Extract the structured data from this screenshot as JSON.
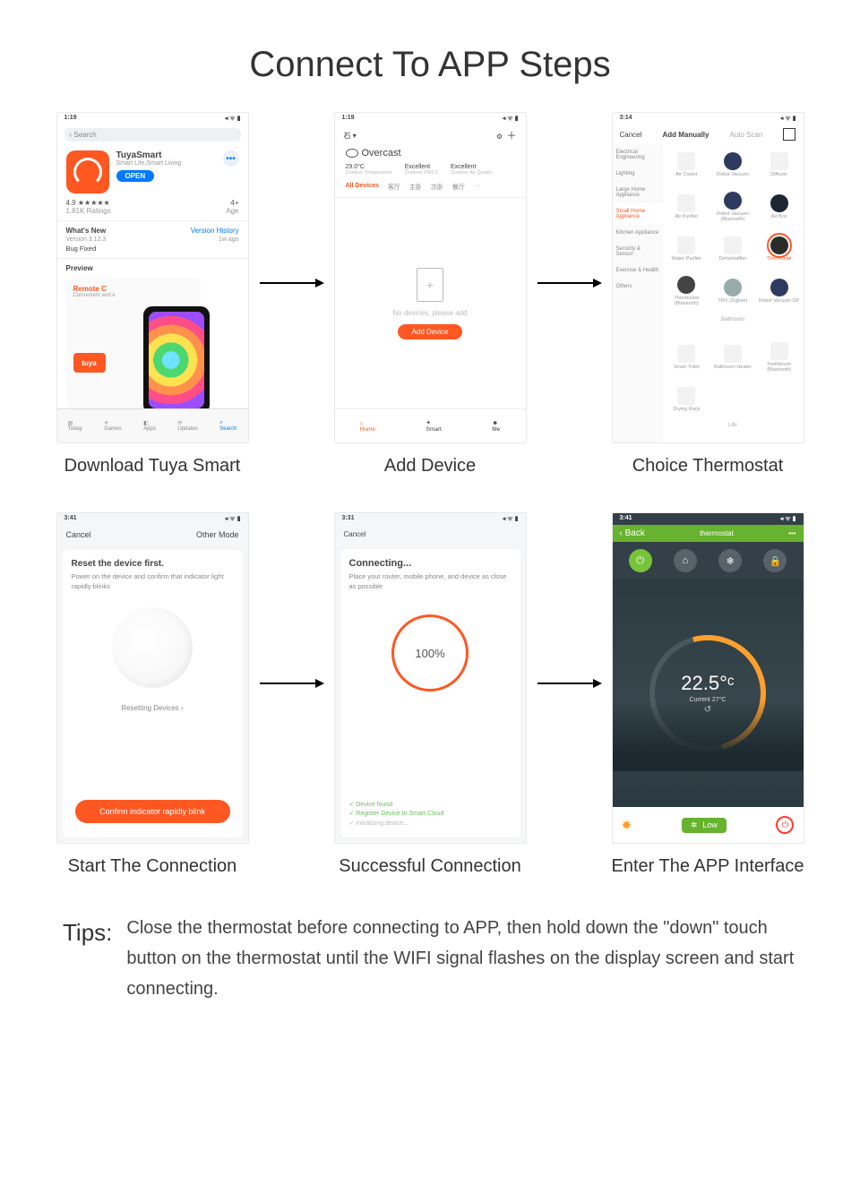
{
  "title": "Connect To APP Steps",
  "captions": {
    "step1": "Download Tuya Smart",
    "step2": "Add Device",
    "step3": "Choice Thermostat",
    "step4": "Start The Connection",
    "step5": "Successful Connection",
    "step6": "Enter The APP Interface"
  },
  "tips": {
    "label": "Tips:",
    "body": "Close the thermostat before connecting to APP, then hold down the \"down\" touch button on the thermostat until the WIFI signal flashes on the display screen and start connecting."
  },
  "step1": {
    "time": "1:19",
    "signal": "◂ ᯤ ▮",
    "search": "Search",
    "appName": "TuyaSmart",
    "appSub": "Smart Life.Smart Living",
    "open": "OPEN",
    "rating": "4.9 ★★★★★",
    "ratingSub": "1.81K Ratings",
    "age": "4+",
    "ageSub": "Age",
    "whatsnew": "What's New",
    "version_history": "Version History",
    "version": "Version 3.12.3",
    "ago": "1w ago",
    "bug": "Bug Fixed",
    "preview": "Preview",
    "remote": "Remote C",
    "remoteSub": "Convenient and e",
    "logo": "tuya",
    "tabs": [
      "Today",
      "Games",
      "Apps",
      "Updates",
      "Search"
    ]
  },
  "step2": {
    "time": "1:19",
    "home_dd": "石 ▾",
    "mic": "⚙",
    "plus": "+",
    "weather": "Overcast",
    "stats": [
      {
        "v": "29.0°C",
        "l": "Outdoor Temperature"
      },
      {
        "v": "Excellent",
        "l": "Outdoor PM2.5"
      },
      {
        "v": "Excellent",
        "l": "Outdoor Air Quality"
      }
    ],
    "tabs": [
      "All Devices",
      "客厅",
      "主卧",
      "次卧",
      "餐厅",
      "···"
    ],
    "noDev": "No devices, please add",
    "addBtn": "Add Device",
    "bottomTabs": [
      "Home",
      "Smart",
      "Me"
    ]
  },
  "step3": {
    "time": "3:14",
    "cancel": "Cancel",
    "addManually": "Add Manually",
    "autoScan": "Auto Scan",
    "side": [
      "Electrical Engineering",
      "Lighting",
      "Large Home Appliance",
      "Small Home Appliance",
      "Kitchen Appliance",
      "Security & Sensor",
      "Exercise & Health",
      "Others"
    ],
    "items_r1": [
      "Air Cooler",
      "Robot Vacuum",
      "Diffuser"
    ],
    "items_r2": [
      "Air Purifier",
      "Robot Vacuum (Bluetooth)",
      "Air Box"
    ],
    "items_r3": [
      "Water Purifier",
      "Dehumidifier",
      "Thermostat"
    ],
    "items_r4": [
      "Thermostat (Bluetooth)",
      "TRV (Zigbee)",
      "Robot Vacuum GP"
    ],
    "sect1": "Bathroom",
    "items_r5": [
      "Smart Toilet",
      "Bathroom Heater",
      "Toothbrush (Bluetooth)"
    ],
    "items_r6": [
      "Drying Rack",
      "",
      ""
    ],
    "sect2": "Life"
  },
  "step4": {
    "time": "3:41",
    "cancel": "Cancel",
    "other": "Other Mode",
    "heading": "Reset the device first.",
    "body": "Power on the device and confirm that indicator light rapidly blinks",
    "link": "Resetting Devices ›",
    "confirm": "Confirm indicator rapidly blink"
  },
  "step5": {
    "time": "3:31",
    "cancel": "Cancel",
    "heading": "Connecting...",
    "body": "Place your router, mobile phone, and device as close as possible",
    "pct": "100%",
    "chk1": "✓ Device found",
    "chk2": "✓ Register Device to Smart Cloud",
    "chk3": "✓ Initializing device..."
  },
  "step6": {
    "time": "3:41",
    "back": "‹ Back",
    "title": "thermostat",
    "more": "•••",
    "temp": "22.5°ᶜ",
    "current": "Current 27°C",
    "fan": "Low"
  }
}
